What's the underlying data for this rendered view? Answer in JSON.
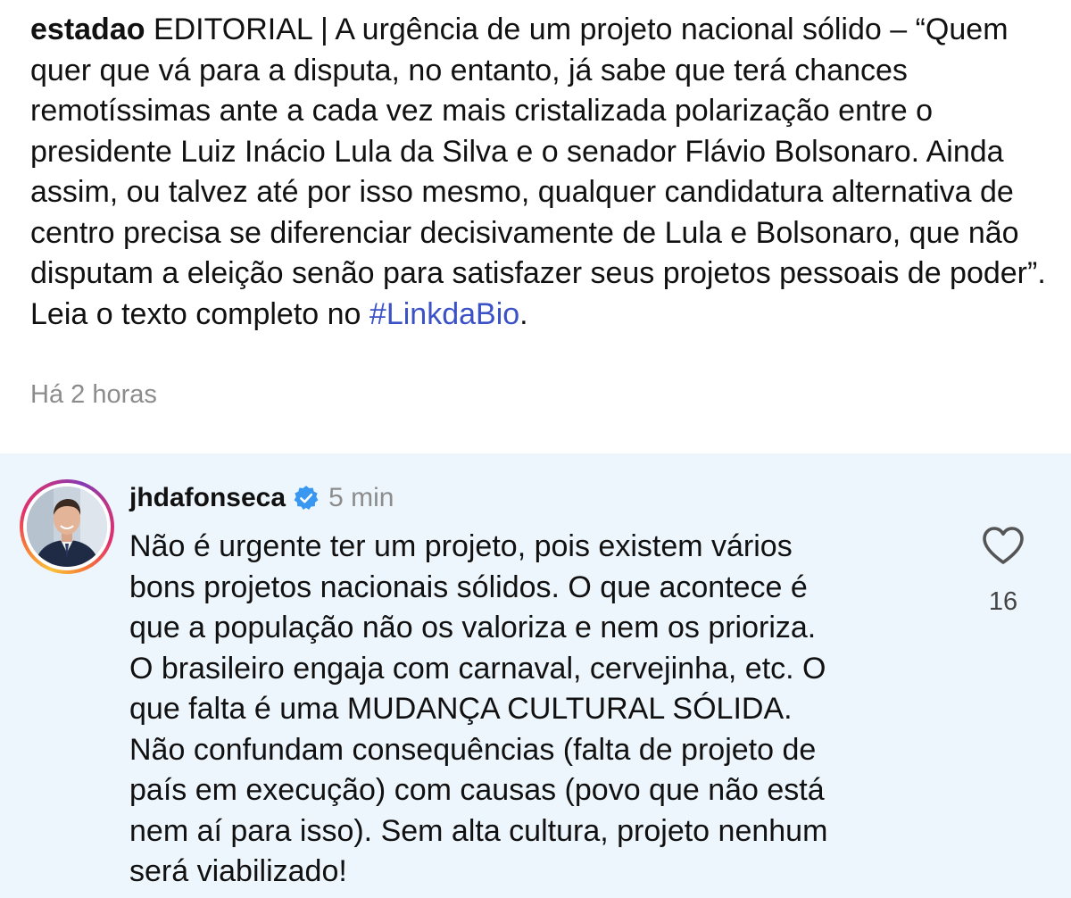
{
  "caption": {
    "username": "estadao",
    "text_before_hashtag": "EDITORIAL | A urgência de um projeto nacional sólido – “Quem quer que vá para a disputa, no entanto, já sabe que terá chances remotíssimas ante a cada vez mais cristalizada polarização entre o presidente Luiz Inácio Lula da Silva e o senador Flávio Bolsonaro. Ainda assim, ou talvez até por isso mesmo, qualquer candidatura alternativa de centro precisa se diferenciar decisivamente de Lula e Bolsonaro, que não disputam a eleição senão para satisfazer seus projetos pessoais de poder”. Leia o texto completo no",
    "hashtag": "#LinkdaBio",
    "text_after_hashtag": ".",
    "time": "Há 2 horas"
  },
  "comment": {
    "username": "jhdafonseca",
    "verified_icon": "verified-badge-icon",
    "time": "5 min",
    "text": "Não é urgente ter um projeto, pois existem vários\nbons projetos nacionais sólidos. O que acontece é\nque a população não os valoriza e nem os prioriza.\nO brasileiro engaja com carnaval, cervejinha, etc. O\nque falta é uma MUDANÇA CULTURAL SÓLIDA.\nNão confundam consequências (falta de projeto de\npaís em execução) com causas (povo que não está\nnem aí para isso). Sem alta cultura, projeto nenhum\nserá viabilizado!",
    "like_icon": "heart-outline-icon",
    "like_count": "16"
  },
  "colors": {
    "background": "#ffffff",
    "comment_highlight": "#eef6fd",
    "hashtag": "#3b52c7",
    "verified_badge": "#3897f0",
    "muted_text": "#8c8c8c"
  }
}
